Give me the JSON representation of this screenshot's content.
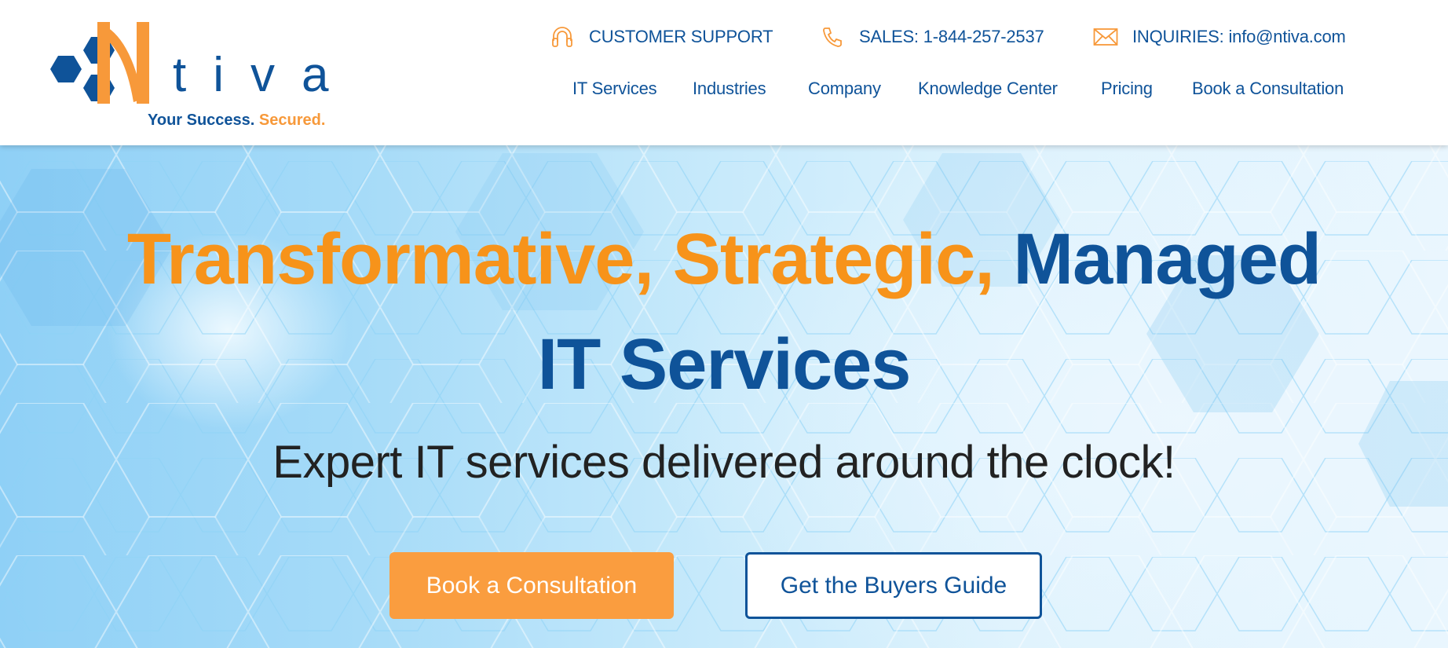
{
  "brand": {
    "name_suffix": "tiva",
    "tagline_primary": "Your Success.",
    "tagline_accent": "Secured.",
    "colors": {
      "primary_blue": "#0f5399",
      "accent_orange": "#f7993a",
      "headline_orange": "#f7931a"
    }
  },
  "contacts": [
    {
      "icon": "headset-icon",
      "label": "CUSTOMER SUPPORT"
    },
    {
      "icon": "phone-icon",
      "label": "SALES: 1-844-257-2537"
    },
    {
      "icon": "envelope-icon",
      "label": "INQUIRIES: info@ntiva.com"
    }
  ],
  "nav": {
    "items": [
      {
        "label": "IT Services"
      },
      {
        "label": "Industries"
      },
      {
        "label": "Company"
      },
      {
        "label": "Knowledge Center"
      },
      {
        "label": "Pricing"
      },
      {
        "label": "Book a Consultation"
      }
    ]
  },
  "hero": {
    "headline_orange": "Transformative, Strategic,",
    "headline_blue_1": "Managed",
    "headline_blue_2": "IT Services",
    "subheadline": "Expert IT services delivered around the clock!",
    "primary_cta": "Book a Consultation",
    "secondary_cta": "Get the Buyers Guide"
  }
}
